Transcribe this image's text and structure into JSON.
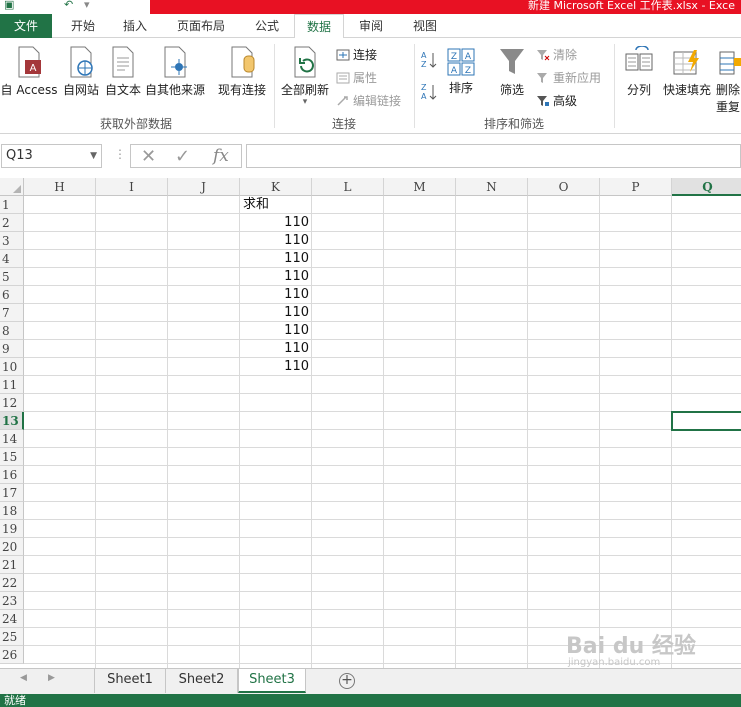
{
  "window": {
    "title": "新建 Microsoft Excel 工作表.xlsx - Exce"
  },
  "tabs": {
    "file": "文件",
    "home": "开始",
    "insert": "插入",
    "layout": "页面布局",
    "formulas": "公式",
    "data": "数据",
    "review": "审阅",
    "view": "视图"
  },
  "ribbon": {
    "external": {
      "access": "自 Access",
      "web": "自网站",
      "text": "自文本",
      "other": "自其他来源",
      "existing": "现有连接",
      "group": "获取外部数据"
    },
    "connections": {
      "refresh_all": "全部刷新",
      "connections": "连接",
      "properties": "属性",
      "edit_links": "编辑链接",
      "group": "连接"
    },
    "sort_filter": {
      "sort_az": "A→Z",
      "sort_za": "Z→A",
      "sort": "排序",
      "filter": "筛选",
      "clear": "清除",
      "reapply": "重新应用",
      "advanced": "高级",
      "group": "排序和筛选"
    },
    "tools": {
      "text_to_columns": "分列",
      "flash_fill": "快速填充",
      "remove_dup_1": "删除",
      "remove_dup_2": "重复"
    }
  },
  "formula_bar": {
    "name_box": "Q13",
    "fx": "fx",
    "value": ""
  },
  "grid": {
    "columns": [
      "H",
      "I",
      "J",
      "K",
      "L",
      "M",
      "N",
      "O",
      "P",
      "Q"
    ],
    "selected_column": "Q",
    "rows": [
      "1",
      "2",
      "3",
      "4",
      "5",
      "6",
      "7",
      "8",
      "9",
      "10",
      "11",
      "12",
      "13",
      "14",
      "15",
      "16",
      "17",
      "18",
      "19",
      "20",
      "21",
      "22",
      "23",
      "24",
      "25",
      "26"
    ],
    "selected_row": "13",
    "header_cell": "求和",
    "values": [
      "110",
      "110",
      "110",
      "110",
      "110",
      "110",
      "110",
      "110",
      "110"
    ]
  },
  "sheets": {
    "tabs": [
      "Sheet1",
      "Sheet2",
      "Sheet3"
    ],
    "active": "Sheet3"
  },
  "status": {
    "text": "就绪"
  },
  "watermark": {
    "main": "Bai du 经验",
    "sub": "jingyan.baidu.com"
  },
  "colors": {
    "excel_green": "#217346",
    "title_red": "#e81123"
  }
}
